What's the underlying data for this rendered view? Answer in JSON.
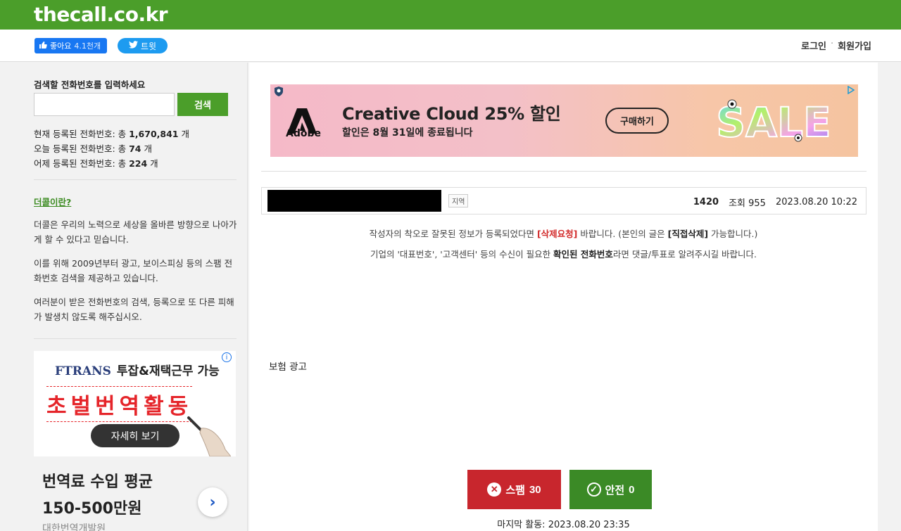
{
  "site": {
    "logo": "thecall.co.kr"
  },
  "social": {
    "fb_like_label": "좋아요",
    "fb_like_count": "4.1천개",
    "tweet_label": "트윗"
  },
  "auth": {
    "login": "로그인",
    "separator": "·",
    "signup": "회원가입"
  },
  "sidebar": {
    "search_heading": "검색할 전화번호를 입력하세요",
    "search_value": "",
    "search_button": "검색",
    "stats": [
      {
        "prefix": "현재 등록된 전화번호: 총 ",
        "value": "1,670,841",
        "suffix": " 개"
      },
      {
        "prefix": "오늘 등록된 전화번호: 총 ",
        "value": "74",
        "suffix": " 개"
      },
      {
        "prefix": "어제 등록된 전화번호: 총 ",
        "value": "224",
        "suffix": " 개"
      }
    ],
    "about_link": "더콜이란?",
    "about_paragraphs": [
      "더콜은 우리의 노력으로 세상을 올바른 방향으로 나아가게 할 수 있다고 믿습니다.",
      "이를 위해 2009년부터 광고, 보이스피싱 등의 스팸 전화번호 검색을 제공하고 있습니다.",
      "여러분이 받은 전화번호의 검색, 등록으로 또 다른 피해가 발생치 않도록 해주십시오."
    ],
    "ad": {
      "brand": "FTRANS",
      "tagline": "투잡&재택근무 가능",
      "headline": "초벌번역활동",
      "detail_button": "자세히 보기",
      "line1": "번역료 수입 평균",
      "line2": "150-500만원",
      "line3": "대한번역개발원",
      "next_arrow": "›"
    }
  },
  "top_ad": {
    "brand": "Adobe",
    "title": "Creative Cloud 25% 할인",
    "subtitle": "할인은 8월 31일에 종료됩니다",
    "button": "구매하기",
    "sale_art": "SALE"
  },
  "post": {
    "region_tag": "지역",
    "number": "1420",
    "views_label": "조회",
    "views": "955",
    "datetime": "2023.08.20 10:22"
  },
  "notice": {
    "line1_a": "작성자의 착오로 잘못된 정보가 등록되었다면 ",
    "line1_red": "[삭제요청]",
    "line1_b": " 바랍니다. (본인의 글은 ",
    "line1_bold": "[직접삭제]",
    "line1_c": " 가능합니다.)",
    "line2_a": "기업의 '대표번호', '고객센터' 등의 수신이 필요한 ",
    "line2_bold": "확인된 전화번호",
    "line2_b": "라면 댓글/투표로 알려주시길 바랍니다."
  },
  "post_body": "보험 광고",
  "votes": {
    "spam_label": "스팸",
    "spam_count": "30",
    "safe_label": "안전",
    "safe_count": "0"
  },
  "last_activity": "마지막 활동: 2023.08.20 23:35",
  "colors": {
    "brand_green": "#4b9e2a",
    "spam_red": "#c8262d",
    "safe_green": "#3b8a26",
    "fb_blue": "#1877f2",
    "twitter_blue": "#1d9bf0"
  }
}
